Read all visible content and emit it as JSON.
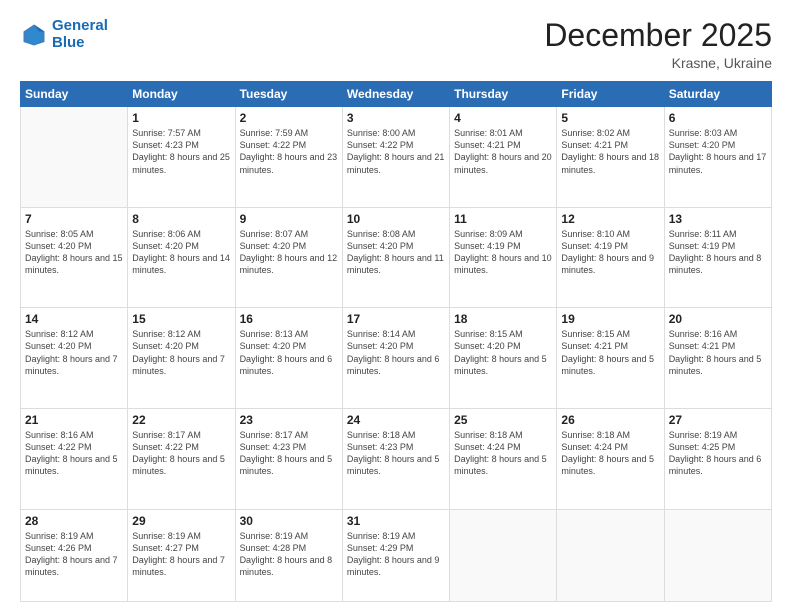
{
  "header": {
    "logo_line1": "General",
    "logo_line2": "Blue",
    "month_title": "December 2025",
    "location": "Krasne, Ukraine"
  },
  "weekdays": [
    "Sunday",
    "Monday",
    "Tuesday",
    "Wednesday",
    "Thursday",
    "Friday",
    "Saturday"
  ],
  "weeks": [
    [
      {
        "day": "",
        "sunrise": "",
        "sunset": "",
        "daylight": ""
      },
      {
        "day": "1",
        "sunrise": "Sunrise: 7:57 AM",
        "sunset": "Sunset: 4:23 PM",
        "daylight": "Daylight: 8 hours and 25 minutes."
      },
      {
        "day": "2",
        "sunrise": "Sunrise: 7:59 AM",
        "sunset": "Sunset: 4:22 PM",
        "daylight": "Daylight: 8 hours and 23 minutes."
      },
      {
        "day": "3",
        "sunrise": "Sunrise: 8:00 AM",
        "sunset": "Sunset: 4:22 PM",
        "daylight": "Daylight: 8 hours and 21 minutes."
      },
      {
        "day": "4",
        "sunrise": "Sunrise: 8:01 AM",
        "sunset": "Sunset: 4:21 PM",
        "daylight": "Daylight: 8 hours and 20 minutes."
      },
      {
        "day": "5",
        "sunrise": "Sunrise: 8:02 AM",
        "sunset": "Sunset: 4:21 PM",
        "daylight": "Daylight: 8 hours and 18 minutes."
      },
      {
        "day": "6",
        "sunrise": "Sunrise: 8:03 AM",
        "sunset": "Sunset: 4:20 PM",
        "daylight": "Daylight: 8 hours and 17 minutes."
      }
    ],
    [
      {
        "day": "7",
        "sunrise": "Sunrise: 8:05 AM",
        "sunset": "Sunset: 4:20 PM",
        "daylight": "Daylight: 8 hours and 15 minutes."
      },
      {
        "day": "8",
        "sunrise": "Sunrise: 8:06 AM",
        "sunset": "Sunset: 4:20 PM",
        "daylight": "Daylight: 8 hours and 14 minutes."
      },
      {
        "day": "9",
        "sunrise": "Sunrise: 8:07 AM",
        "sunset": "Sunset: 4:20 PM",
        "daylight": "Daylight: 8 hours and 12 minutes."
      },
      {
        "day": "10",
        "sunrise": "Sunrise: 8:08 AM",
        "sunset": "Sunset: 4:20 PM",
        "daylight": "Daylight: 8 hours and 11 minutes."
      },
      {
        "day": "11",
        "sunrise": "Sunrise: 8:09 AM",
        "sunset": "Sunset: 4:19 PM",
        "daylight": "Daylight: 8 hours and 10 minutes."
      },
      {
        "day": "12",
        "sunrise": "Sunrise: 8:10 AM",
        "sunset": "Sunset: 4:19 PM",
        "daylight": "Daylight: 8 hours and 9 minutes."
      },
      {
        "day": "13",
        "sunrise": "Sunrise: 8:11 AM",
        "sunset": "Sunset: 4:19 PM",
        "daylight": "Daylight: 8 hours and 8 minutes."
      }
    ],
    [
      {
        "day": "14",
        "sunrise": "Sunrise: 8:12 AM",
        "sunset": "Sunset: 4:20 PM",
        "daylight": "Daylight: 8 hours and 7 minutes."
      },
      {
        "day": "15",
        "sunrise": "Sunrise: 8:12 AM",
        "sunset": "Sunset: 4:20 PM",
        "daylight": "Daylight: 8 hours and 7 minutes."
      },
      {
        "day": "16",
        "sunrise": "Sunrise: 8:13 AM",
        "sunset": "Sunset: 4:20 PM",
        "daylight": "Daylight: 8 hours and 6 minutes."
      },
      {
        "day": "17",
        "sunrise": "Sunrise: 8:14 AM",
        "sunset": "Sunset: 4:20 PM",
        "daylight": "Daylight: 8 hours and 6 minutes."
      },
      {
        "day": "18",
        "sunrise": "Sunrise: 8:15 AM",
        "sunset": "Sunset: 4:20 PM",
        "daylight": "Daylight: 8 hours and 5 minutes."
      },
      {
        "day": "19",
        "sunrise": "Sunrise: 8:15 AM",
        "sunset": "Sunset: 4:21 PM",
        "daylight": "Daylight: 8 hours and 5 minutes."
      },
      {
        "day": "20",
        "sunrise": "Sunrise: 8:16 AM",
        "sunset": "Sunset: 4:21 PM",
        "daylight": "Daylight: 8 hours and 5 minutes."
      }
    ],
    [
      {
        "day": "21",
        "sunrise": "Sunrise: 8:16 AM",
        "sunset": "Sunset: 4:22 PM",
        "daylight": "Daylight: 8 hours and 5 minutes."
      },
      {
        "day": "22",
        "sunrise": "Sunrise: 8:17 AM",
        "sunset": "Sunset: 4:22 PM",
        "daylight": "Daylight: 8 hours and 5 minutes."
      },
      {
        "day": "23",
        "sunrise": "Sunrise: 8:17 AM",
        "sunset": "Sunset: 4:23 PM",
        "daylight": "Daylight: 8 hours and 5 minutes."
      },
      {
        "day": "24",
        "sunrise": "Sunrise: 8:18 AM",
        "sunset": "Sunset: 4:23 PM",
        "daylight": "Daylight: 8 hours and 5 minutes."
      },
      {
        "day": "25",
        "sunrise": "Sunrise: 8:18 AM",
        "sunset": "Sunset: 4:24 PM",
        "daylight": "Daylight: 8 hours and 5 minutes."
      },
      {
        "day": "26",
        "sunrise": "Sunrise: 8:18 AM",
        "sunset": "Sunset: 4:24 PM",
        "daylight": "Daylight: 8 hours and 5 minutes."
      },
      {
        "day": "27",
        "sunrise": "Sunrise: 8:19 AM",
        "sunset": "Sunset: 4:25 PM",
        "daylight": "Daylight: 8 hours and 6 minutes."
      }
    ],
    [
      {
        "day": "28",
        "sunrise": "Sunrise: 8:19 AM",
        "sunset": "Sunset: 4:26 PM",
        "daylight": "Daylight: 8 hours and 7 minutes."
      },
      {
        "day": "29",
        "sunrise": "Sunrise: 8:19 AM",
        "sunset": "Sunset: 4:27 PM",
        "daylight": "Daylight: 8 hours and 7 minutes."
      },
      {
        "day": "30",
        "sunrise": "Sunrise: 8:19 AM",
        "sunset": "Sunset: 4:28 PM",
        "daylight": "Daylight: 8 hours and 8 minutes."
      },
      {
        "day": "31",
        "sunrise": "Sunrise: 8:19 AM",
        "sunset": "Sunset: 4:29 PM",
        "daylight": "Daylight: 8 hours and 9 minutes."
      },
      {
        "day": "",
        "sunrise": "",
        "sunset": "",
        "daylight": ""
      },
      {
        "day": "",
        "sunrise": "",
        "sunset": "",
        "daylight": ""
      },
      {
        "day": "",
        "sunrise": "",
        "sunset": "",
        "daylight": ""
      }
    ]
  ]
}
